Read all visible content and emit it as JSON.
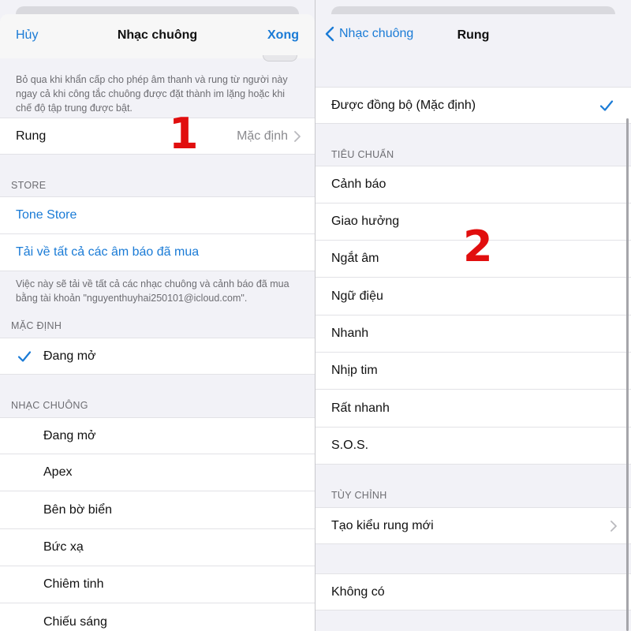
{
  "left": {
    "nav": {
      "cancel": "Hủy",
      "title": "Nhạc chuông",
      "done": "Xong"
    },
    "emergency_note": "Bỏ qua khi khẩn cấp cho phép âm thanh và rung từ người này ngay cả khi công tắc chuông được đặt thành im lặng hoặc khi chế độ tập trung được bật.",
    "vibration_row": {
      "label": "Rung",
      "value": "Mặc định"
    },
    "annotation": "1",
    "store": {
      "header": "STORE",
      "tone_store": "Tone Store",
      "download_all": "Tải về tất cả các âm báo đã mua",
      "note": "Việc này sẽ tải về tất cả các nhạc chuông và cảnh báo đã mua bằng tài khoản \"nguyenthuyhai250101@icloud.com\"."
    },
    "default_section": {
      "header": "MẶC ĐỊNH",
      "item": "Đang mở"
    },
    "ringtones": {
      "header": "NHẠC CHUÔNG",
      "items": [
        "Đang mở",
        "Apex",
        "Bên bờ biển",
        "Bức xạ",
        "Chiêm tinh",
        "Chiếu sáng"
      ]
    }
  },
  "right": {
    "nav": {
      "back": "Nhạc chuông",
      "title": "Rung"
    },
    "synced": "Được đồng bộ (Mặc định)",
    "annotation": "2",
    "standard": {
      "header": "TIÊU CHUẨN",
      "items": [
        "Cảnh báo",
        "Giao hưởng",
        "Ngắt âm",
        "Ngữ điệu",
        "Nhanh",
        "Nhịp tim",
        "Rất nhanh",
        "S.O.S."
      ]
    },
    "custom": {
      "header": "TÙY CHỈNH",
      "create": "Tạo kiểu rung mới"
    },
    "none": "Không có"
  },
  "colors": {
    "accent": "#1a7bd6",
    "annotation": "#e10e0e",
    "background": "#f2f2f7"
  }
}
